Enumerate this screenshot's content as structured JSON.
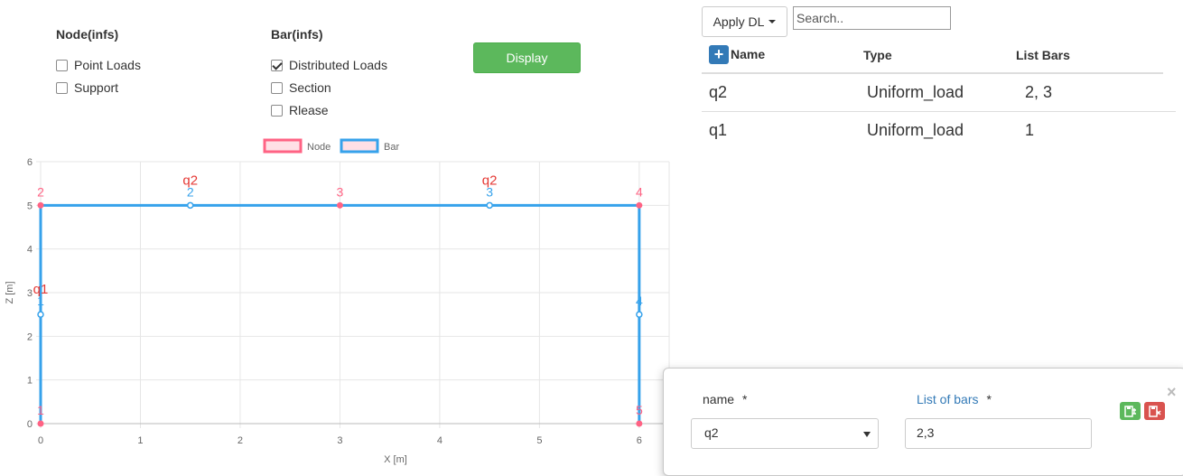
{
  "filters": {
    "node": {
      "title": "Node(infs)",
      "options": [
        {
          "label": "Point Loads",
          "checked": false
        },
        {
          "label": "Support",
          "checked": false
        }
      ]
    },
    "bar": {
      "title": "Bar(infs)",
      "options": [
        {
          "label": "Distributed Loads",
          "checked": true
        },
        {
          "label": "Section",
          "checked": false
        },
        {
          "label": "Rlease",
          "checked": false
        }
      ]
    },
    "display_label": "Display"
  },
  "chart_data": {
    "type": "scatter",
    "xlabel": "X [m]",
    "ylabel": "Z [m]",
    "xlim": [
      0,
      6.3
    ],
    "ylim": [
      0,
      6
    ],
    "x_ticks": [
      0,
      1,
      2,
      3,
      4,
      5,
      6
    ],
    "y_ticks": [
      0,
      1,
      2,
      3,
      4,
      5,
      6
    ],
    "grid": true,
    "legend": [
      {
        "name": "Node",
        "color": "#ff6384"
      },
      {
        "name": "Bar",
        "color": "#36a2eb"
      }
    ],
    "nodes": [
      {
        "id": "1",
        "x": 0,
        "z": 0
      },
      {
        "id": "2",
        "x": 0,
        "z": 5
      },
      {
        "id": "3",
        "x": 3,
        "z": 5
      },
      {
        "id": "4",
        "x": 6,
        "z": 5
      },
      {
        "id": "5",
        "x": 6,
        "z": 0
      }
    ],
    "bars": [
      {
        "id": "1",
        "from": [
          0,
          0
        ],
        "to": [
          0,
          5
        ],
        "mid": [
          0,
          2.5
        ]
      },
      {
        "id": "2",
        "from": [
          0,
          5
        ],
        "to": [
          3,
          5
        ],
        "mid": [
          1.5,
          5
        ]
      },
      {
        "id": "3",
        "from": [
          3,
          5
        ],
        "to": [
          6,
          5
        ],
        "mid": [
          4.5,
          5
        ]
      },
      {
        "id": "4",
        "from": [
          6,
          5
        ],
        "to": [
          6,
          0
        ],
        "mid": [
          6,
          2.5
        ]
      }
    ],
    "load_labels": [
      {
        "text": "q2",
        "x": 1.5,
        "z": 5
      },
      {
        "text": "q2",
        "x": 4.5,
        "z": 5
      },
      {
        "text": "q1",
        "x": 0,
        "z": 2.5
      }
    ]
  },
  "toolbar": {
    "apply_label": "Apply DL",
    "search_placeholder": "Search.."
  },
  "table": {
    "add_icon": "plus-icon",
    "headers": [
      "Name",
      "Type",
      "List Bars"
    ],
    "rows": [
      {
        "name": "q2",
        "type": "Uniform_load",
        "bars": "2, 3"
      },
      {
        "name": "q1",
        "type": "Uniform_load",
        "bars": "1"
      }
    ]
  },
  "edit_panel": {
    "name_label": "name",
    "bars_label": "List of bars",
    "required_mark": "*",
    "name_value": "q2",
    "bars_value": "2,3",
    "save_icon": "save-icon",
    "delete_icon": "delete-icon",
    "close_label": "×",
    "colors": {
      "save": "#5cb85c",
      "delete": "#d9534f"
    }
  }
}
